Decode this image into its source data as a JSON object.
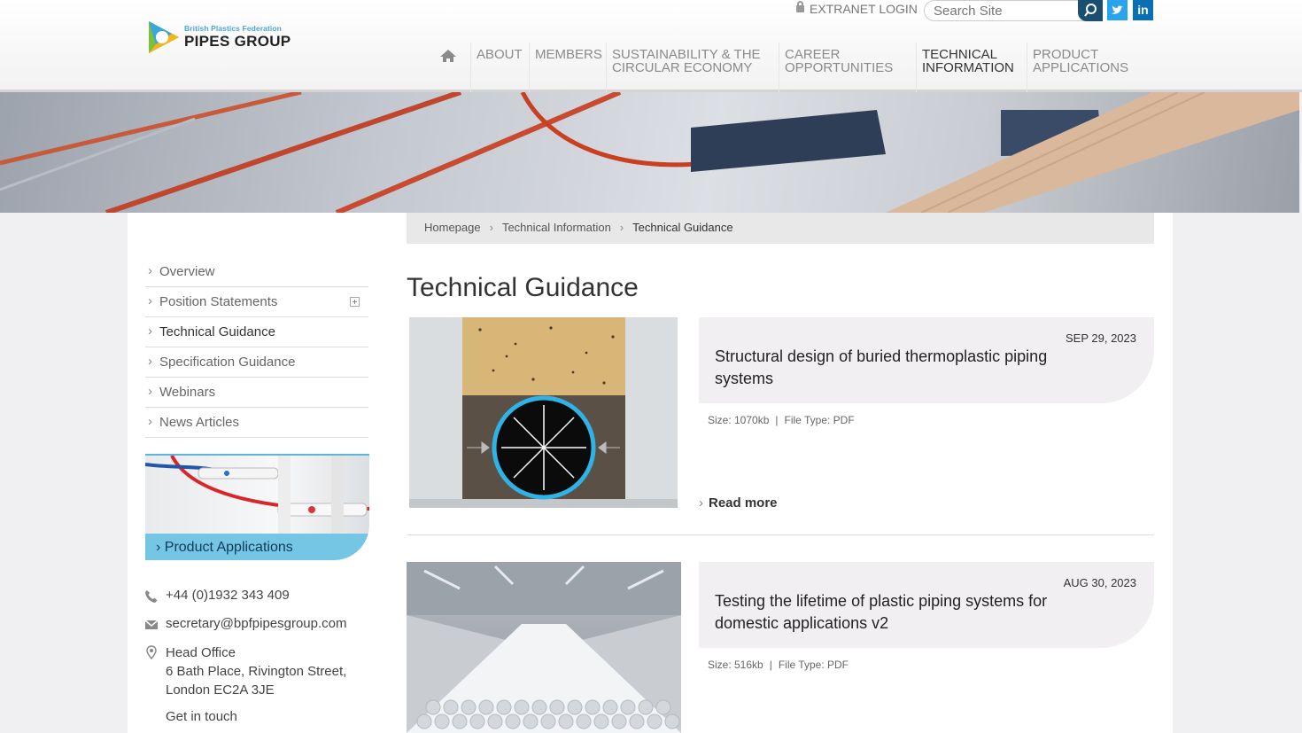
{
  "header": {
    "logo_small": "British Plastics Federation",
    "logo_big": "PIPES GROUP",
    "extranet_login": "EXTRANET LOGIN",
    "search_placeholder": "Search Site",
    "social_twitter": "t",
    "social_linkedin": "in"
  },
  "nav": {
    "about": "ABOUT",
    "members": "MEMBERS",
    "sustainability_1": "SUSTAINABILITY & THE",
    "sustainability_2": "CIRCULAR ECONOMY",
    "career_1": "CAREER",
    "career_2": "OPPORTUNITIES",
    "technical_1": "TECHNICAL",
    "technical_2": "INFORMATION",
    "product_1": "PRODUCT",
    "product_2": "APPLICATIONS"
  },
  "breadcrumb": [
    "Homepage",
    "Technical Information",
    "Technical Guidance"
  ],
  "sidebar": {
    "items": [
      {
        "label": "Overview"
      },
      {
        "label": "Position Statements"
      },
      {
        "label": "Technical Guidance"
      },
      {
        "label": "Specification Guidance"
      },
      {
        "label": "Webinars"
      },
      {
        "label": "News Articles"
      }
    ],
    "promo_label": "› Product Applications"
  },
  "contact": {
    "phone": "+44 (0)1932 343 409",
    "email": "secretary@bpfpipesgroup.com",
    "office_title": "Head Office",
    "address_1": "6 Bath Place, Rivington Street,",
    "address_2": "London EC2A 3JE",
    "get_in_touch": "Get in touch"
  },
  "page_title": "Technical Guidance",
  "articles": [
    {
      "date": "SEP 29, 2023",
      "title": "Structural design of buried thermoplastic piping systems",
      "size": "Size: 1070kb",
      "type": "File Type: PDF",
      "read_more": "Read more"
    },
    {
      "date": "AUG 30, 2023",
      "title": "Testing the lifetime of plastic piping systems for domestic applications v2",
      "size": "Size: 516kb",
      "type": "File Type: PDF"
    }
  ],
  "colors": {
    "accent_blue": "#1b4f72",
    "promo_blue": "#74c6e4",
    "twitter": "#2aa3ef",
    "linkedin": "#0a6fb5"
  }
}
